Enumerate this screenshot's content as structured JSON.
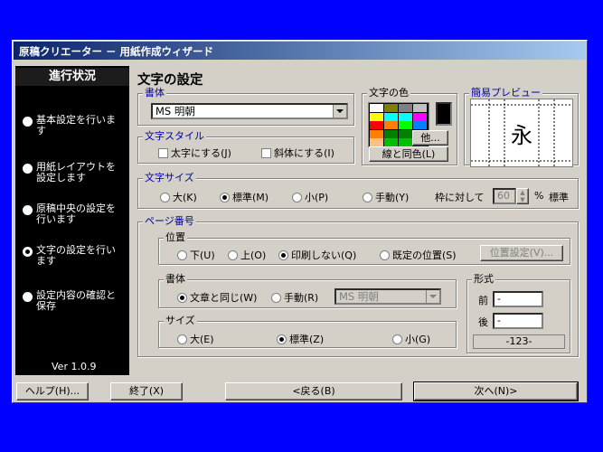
{
  "window": {
    "title": "原稿クリエーター － 用紙作成ウィザード"
  },
  "sidebar": {
    "title": "進行状況",
    "steps": [
      {
        "label": "基本設定を行います",
        "selected": false
      },
      {
        "label": "用紙レイアウトを設定します",
        "selected": false
      },
      {
        "label": "原稿中央の設定を行います",
        "selected": false
      },
      {
        "label": "文字の設定を行います",
        "selected": true
      },
      {
        "label": "設定内容の確認と保存",
        "selected": false
      }
    ],
    "version": "Ver 1.0.9"
  },
  "main": {
    "title": "文字の設定",
    "font": {
      "label": "書体",
      "value": "MS 明朝"
    },
    "style": {
      "label": "文字スタイル",
      "bold": "太字にする(J)",
      "italic": "斜体にする(I)"
    },
    "color": {
      "label": "文字の色",
      "swatches": [
        "#ffffff",
        "#808000",
        "#808080",
        "#c0c0c0",
        "#800080",
        "#ffff00",
        "#00ffff",
        "#00ffff",
        "#ff00ff",
        "#808080",
        "#ff0000",
        "#ff8000",
        "#00ff00",
        "#0080ff",
        "#000080",
        "#ff8000",
        "#008000",
        "#008000",
        "#0000ff",
        "#000000",
        "#ffc080",
        "#00c000",
        "#00c000",
        "#0000c0",
        "#000000"
      ],
      "current": "#000000",
      "other_btn": "他...",
      "same_line_btn": "線と同色(L)"
    },
    "preview": {
      "label": "簡易プレビュー",
      "char": "永"
    },
    "size": {
      "label": "文字サイズ",
      "options": [
        {
          "label": "大(K)",
          "selected": false
        },
        {
          "label": "標準(M)",
          "selected": true
        },
        {
          "label": "小(P)",
          "selected": false
        },
        {
          "label": "手動(Y)",
          "selected": false
        }
      ],
      "relative_label": "枠に対して",
      "percent_value": "60",
      "percent_unit": "%",
      "standard": "標準"
    },
    "page_number": {
      "label": "ページ番号",
      "position": {
        "label": "位置",
        "options": [
          {
            "label": "下(U)",
            "selected": false
          },
          {
            "label": "上(O)",
            "selected": false
          },
          {
            "label": "印刷しない(Q)",
            "selected": true
          },
          {
            "label": "既定の位置(S)",
            "selected": false
          }
        ],
        "setting_btn": "位置設定(V)..."
      },
      "font": {
        "label": "書体",
        "options": [
          {
            "label": "文章と同じ(W)",
            "selected": true
          },
          {
            "label": "手動(R)",
            "selected": false
          }
        ],
        "value": "MS 明朝"
      },
      "size": {
        "label": "サイズ",
        "options": [
          {
            "label": "大(E)",
            "selected": false
          },
          {
            "label": "標準(Z)",
            "selected": true
          },
          {
            "label": "小(G)",
            "selected": false
          }
        ]
      },
      "format": {
        "label": "形式",
        "prefix_label": "前",
        "prefix_value": "-",
        "suffix_label": "後",
        "suffix_value": "-",
        "sample": "-123-"
      }
    }
  },
  "footer": {
    "help": "ヘルプ(H)...",
    "exit": "終了(X)",
    "back": "<戻る(B)",
    "next": "次へ(N)>"
  }
}
